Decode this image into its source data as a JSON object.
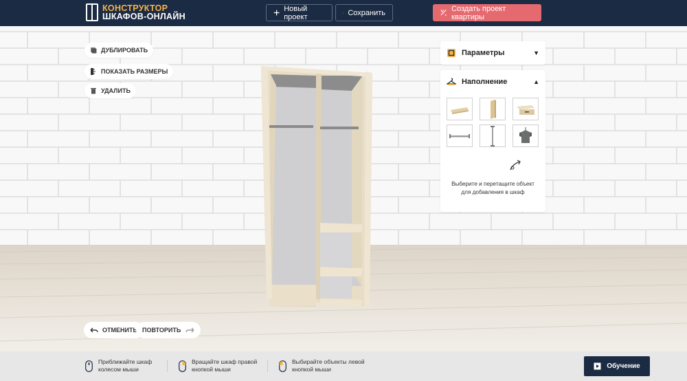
{
  "header": {
    "logo_line1": "КОНСТРУКТОР",
    "logo_line2": "ШКАФОВ-ОНЛАЙН",
    "new_project_label": "Новый проект",
    "save_label": "Сохранить",
    "create_apartment_label": "Создать проект квартиры"
  },
  "toolbar": {
    "duplicate_label": "ДУБЛИРОВАТЬ",
    "show_dimensions_label": "ПОКАЗАТЬ РАЗМЕРЫ",
    "delete_label": "УДАЛИТЬ",
    "undo_label": "ОТМЕНИТЬ",
    "redo_label": "ПОВТОРИТЬ"
  },
  "panels": {
    "params_title": "Параметры",
    "filling_title": "Наполнение",
    "filling_items": [
      {
        "icon": "shelf-icon"
      },
      {
        "icon": "vertical-partition-icon"
      },
      {
        "icon": "drawer-icon"
      },
      {
        "icon": "rail-icon"
      },
      {
        "icon": "vertical-rod-icon"
      },
      {
        "icon": "hanger-icon"
      }
    ],
    "hint_text": "Выберите и перетащите объект для добавления в шкаф"
  },
  "footer": {
    "tip1": "Приближайте шкаф колесом мыши",
    "tip2": "Вращайте шкаф правой кнопкой мыши",
    "tip3": "Выбирайте объекты левой кнопкой мыши",
    "learn_label": "Обучение"
  },
  "colors": {
    "header_bg": "#1c2b44",
    "logo_accent": "#f2b34a",
    "accent_button": "#e56a70",
    "wood": "#eadfc9"
  }
}
